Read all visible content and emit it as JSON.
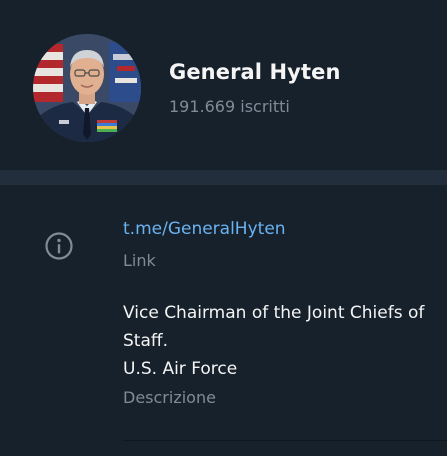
{
  "channel": {
    "name": "General Hyten",
    "subscribers": "191.669 iscritti",
    "avatar_icon": "profile-photo"
  },
  "info": {
    "icon": "info-icon",
    "link": "t.me/GeneralHyten",
    "link_caption": "Link",
    "description_lines": [
      "Vice Chairman of the Joint Chiefs of Staff.",
      "U.S. Air Force"
    ],
    "description_caption": "Descrizione"
  },
  "colors": {
    "background": "#17212b",
    "divider": "#232e3c",
    "link": "#6ab2f2",
    "secondary_text": "#7f8b97",
    "primary_text": "#f5f5f5"
  }
}
